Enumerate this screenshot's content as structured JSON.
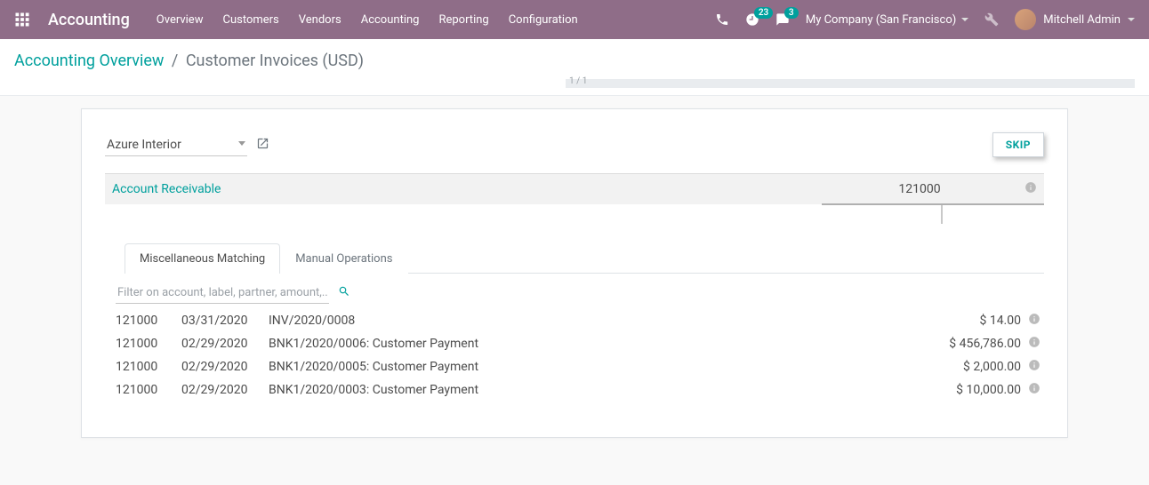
{
  "app_title": "Accounting",
  "nav": [
    "Overview",
    "Customers",
    "Vendors",
    "Accounting",
    "Reporting",
    "Configuration"
  ],
  "topbar": {
    "activities_badge": "23",
    "discuss_badge": "3",
    "company": "My Company (San Francisco)",
    "user": "Mitchell Admin"
  },
  "breadcrumbs": {
    "root": "Accounting Overview",
    "current": "Customer Invoices (USD)"
  },
  "pager": "1 / 1",
  "partner": "Azure Interior",
  "skip_label": "SKIP",
  "account": {
    "name": "Account Receivable",
    "code": "121000"
  },
  "tabs": {
    "misc": "Miscellaneous Matching",
    "manual": "Manual Operations"
  },
  "filter_placeholder": "Filter on account, label, partner, amount,...",
  "lines": [
    {
      "code": "121000",
      "date": "03/31/2020",
      "label": "INV/2020/0008",
      "amount": "$ 14.00"
    },
    {
      "code": "121000",
      "date": "02/29/2020",
      "label": "BNK1/2020/0006: Customer Payment",
      "amount": "$ 456,786.00"
    },
    {
      "code": "121000",
      "date": "02/29/2020",
      "label": "BNK1/2020/0005: Customer Payment",
      "amount": "$ 2,000.00"
    },
    {
      "code": "121000",
      "date": "02/29/2020",
      "label": "BNK1/2020/0003: Customer Payment",
      "amount": "$ 10,000.00"
    }
  ]
}
